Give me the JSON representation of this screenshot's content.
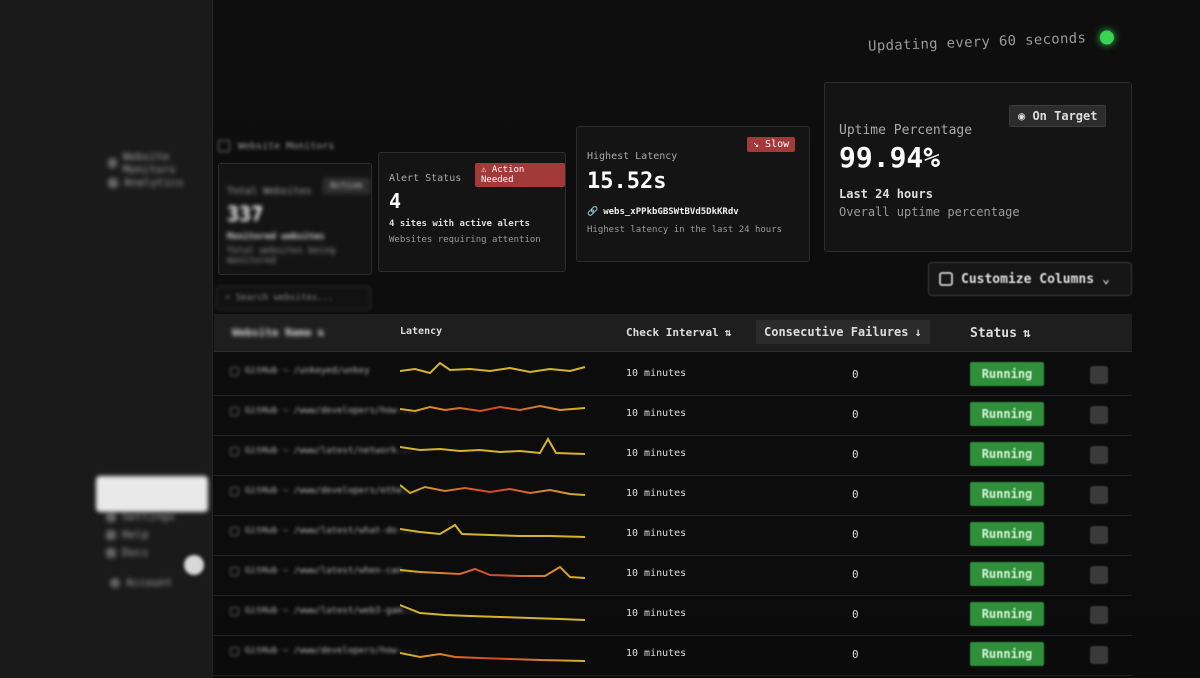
{
  "header": {
    "update_text": "Updating every 60 seconds",
    "breadcrumb": "Website Monitors"
  },
  "sidebar": {
    "items": [
      "Website Monitors",
      "Analytics"
    ],
    "footer_items": [
      "Settings",
      "Help",
      "Docs"
    ],
    "user": "Account"
  },
  "cards": {
    "total": {
      "title": "Total Websites",
      "badge": "Active",
      "value": "337",
      "sub": "Monitored websites",
      "desc": "Total websites being monitored"
    },
    "alerts": {
      "title": "Alert Status",
      "badge": "Action Needed",
      "value": "4",
      "sub": "4 sites with active alerts",
      "desc": "Websites requiring attention"
    },
    "latency": {
      "title": "Highest Latency",
      "badge": "Slow",
      "value": "15.52s",
      "link": "webs_xPPkbGBSWtBVd5DkKRdv",
      "desc": "Highest latency in the last 24 hours"
    },
    "uptime": {
      "title": "Uptime Percentage",
      "badge": "On Target",
      "value": "99.94%",
      "sub": "Last 24 hours",
      "desc": "Overall uptime percentage"
    }
  },
  "toolbar": {
    "search_placeholder": "Search websites...",
    "customize_label": "Customize Columns"
  },
  "table": {
    "columns": [
      "Website Name",
      "Latency",
      "Check Interval",
      "Consecutive Failures",
      "Status"
    ],
    "rows": [
      {
        "site": "GitHub — /unkeyed/unkey",
        "interval": "10 minutes",
        "failures": "0",
        "status": "Running"
      },
      {
        "site": "GitHub — /www/developers/how-...",
        "interval": "10 minutes",
        "failures": "0",
        "status": "Running"
      },
      {
        "site": "GitHub — /www/latest/network...",
        "interval": "10 minutes",
        "failures": "0",
        "status": "Running"
      },
      {
        "site": "GitHub — /www/developers/ethe...",
        "interval": "10 minutes",
        "failures": "0",
        "status": "Running"
      },
      {
        "site": "GitHub — /www/latest/what-do-...",
        "interval": "10 minutes",
        "failures": "0",
        "status": "Running"
      },
      {
        "site": "GitHub — /www/latest/when-can-...",
        "interval": "10 minutes",
        "failures": "0",
        "status": "Running"
      },
      {
        "site": "GitHub — /www/latest/web3-gam...",
        "interval": "10 minutes",
        "failures": "0",
        "status": "Running"
      },
      {
        "site": "GitHub — /www/developers/how-...",
        "interval": "10 minutes",
        "failures": "0",
        "status": "Running"
      }
    ]
  },
  "colors": {
    "running": "#2f8f3a",
    "alert_badge": "#a33a3a",
    "live_dot": "#39d353",
    "spark_low": "#d6b42a",
    "spark_high": "#d6452a"
  }
}
